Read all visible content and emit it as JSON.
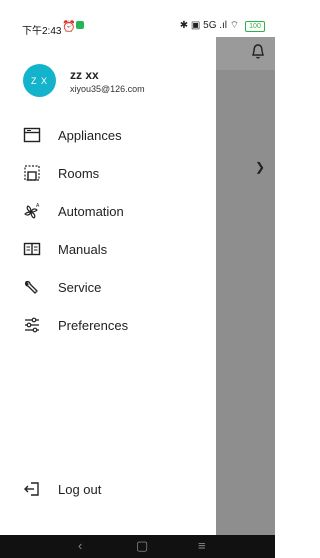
{
  "status": {
    "time": "下午2:43",
    "alarm_icon": "alarm-icon",
    "right_text": "✱ ▣ 5G .ıl ⌔",
    "battery": "100"
  },
  "user": {
    "initials": "Z X",
    "name": "zz xx",
    "email": "xiyou35@126.com"
  },
  "menu": [
    {
      "label": "Appliances",
      "icon": "appliances-icon"
    },
    {
      "label": "Rooms",
      "icon": "rooms-icon"
    },
    {
      "label": "Automation",
      "icon": "automation-icon"
    },
    {
      "label": "Manuals",
      "icon": "manuals-icon"
    },
    {
      "label": "Service",
      "icon": "service-icon"
    },
    {
      "label": "Preferences",
      "icon": "preferences-icon"
    }
  ],
  "logout": {
    "label": "Log out",
    "icon": "logout-icon"
  },
  "nav": {
    "back": "‹",
    "home": "▢",
    "menu": "≡"
  },
  "colors": {
    "avatar": "#13b3cc",
    "dim_background": "#8e8e8e"
  }
}
